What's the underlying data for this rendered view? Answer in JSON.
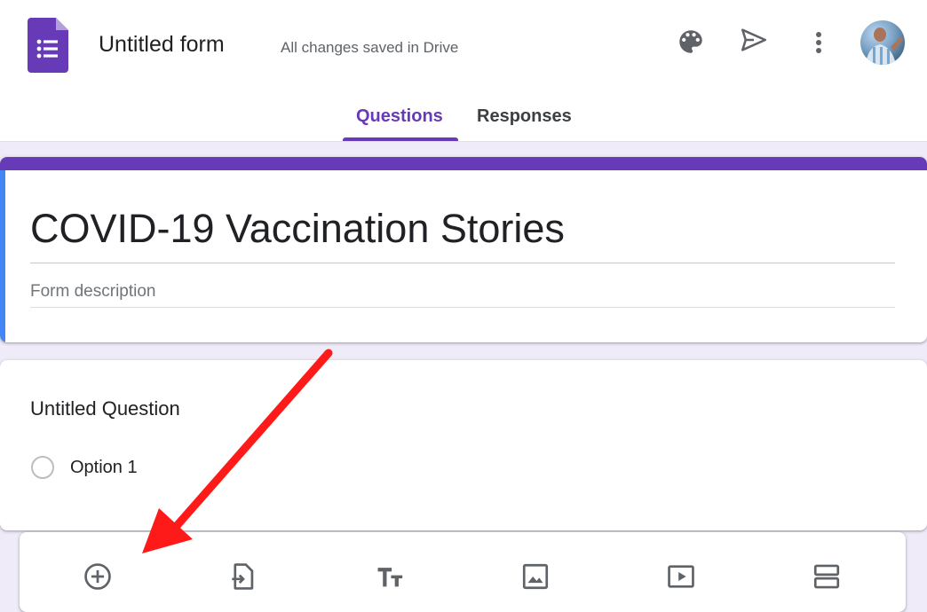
{
  "header": {
    "form_title": "Untitled form",
    "save_status": "All changes saved in Drive",
    "icons": [
      "forms-logo-icon",
      "palette-icon",
      "send-icon",
      "more-vert-icon",
      "avatar"
    ]
  },
  "tabs": [
    {
      "label": "Questions",
      "active": true
    },
    {
      "label": "Responses",
      "active": false
    }
  ],
  "form": {
    "title": "COVID-19 Vaccination Stories",
    "description_placeholder": "Form description"
  },
  "question": {
    "title": "Untitled Question",
    "options": [
      "Option 1"
    ]
  },
  "toolbar": {
    "tools": [
      "add-question-icon",
      "import-questions-icon",
      "add-title-icon",
      "add-image-icon",
      "add-video-icon",
      "add-section-icon"
    ]
  },
  "colors": {
    "accent": "#673ab7",
    "background": "#f0ebf8",
    "title_left_bar": "#4285f4",
    "annotation_arrow": "#ff1a1a"
  }
}
